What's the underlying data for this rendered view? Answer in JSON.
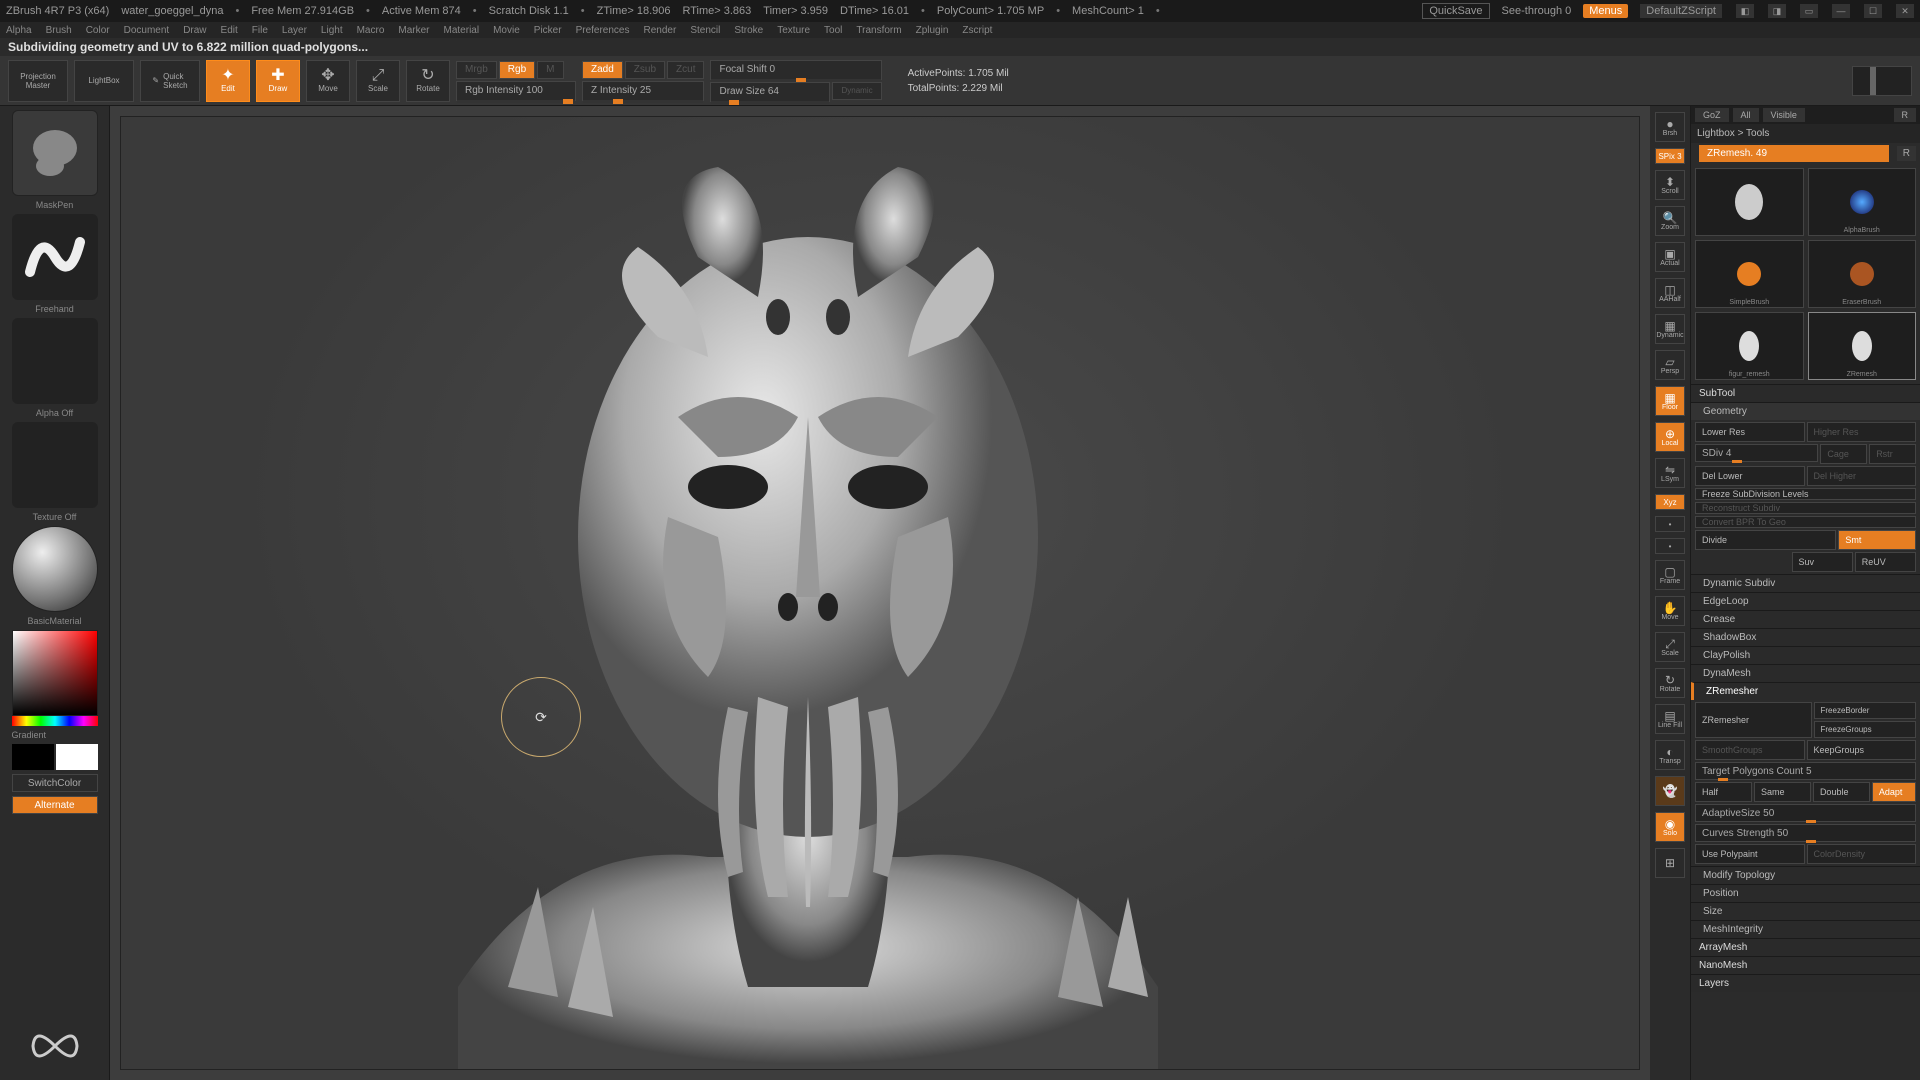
{
  "title_bar": {
    "app": "ZBrush 4R7 P3 (x64)",
    "file": "water_goeggel_dyna",
    "free_mem": "Free Mem 27.914GB",
    "active_mem": "Active Mem 874",
    "scratch": "Scratch Disk 1.1",
    "ztime": "ZTime> 18.906",
    "rtime": "RTime> 3.863",
    "timer": "Timer> 3.959",
    "dtime": "DTime> 16.01",
    "polycount": "PolyCount> 1.705 MP",
    "meshcount": "MeshCount> 1",
    "quicksave": "QuickSave",
    "seethrough": "See-through 0",
    "menus": "Menus",
    "script": "DefaultZScript"
  },
  "menu": [
    "Alpha",
    "Brush",
    "Color",
    "Document",
    "Draw",
    "Edit",
    "File",
    "Layer",
    "Light",
    "Macro",
    "Marker",
    "Material",
    "Movie",
    "Picker",
    "Preferences",
    "Render",
    "Stencil",
    "Stroke",
    "Texture",
    "Tool",
    "Transform",
    "Zplugin",
    "Zscript"
  ],
  "status": "Subdividing geometry and UV to 6.822 million quad-polygons...",
  "toolbar": {
    "projection_master": "Projection\nMaster",
    "lightbox": "LightBox",
    "quick_sketch": "Quick\nSketch",
    "edit": "Edit",
    "draw": "Draw",
    "move": "Move",
    "scale": "Scale",
    "rotate": "Rotate",
    "mrgb": "Mrgb",
    "rgb": "Rgb",
    "m": "M",
    "rgb_intensity": "Rgb Intensity 100",
    "zadd": "Zadd",
    "zsub": "Zsub",
    "zcut": "Zcut",
    "z_intensity": "Z Intensity 25",
    "focal_shift": "Focal Shift 0",
    "draw_size": "Draw Size 64",
    "dynamic": "Dynamic",
    "active_points": "ActivePoints: 1.705 Mil",
    "total_points": "TotalPoints: 2.229 Mil"
  },
  "left": {
    "mask_pen": "MaskPen",
    "freehand": "Freehand",
    "alpha_off": "Alpha Off",
    "texture_off": "Texture Off",
    "material": "BasicMaterial",
    "gradient": "Gradient",
    "switch_color": "SwitchColor",
    "alternate": "Alternate"
  },
  "right_strip": {
    "brsh": "Brsh",
    "spix": "SPix 3",
    "scroll": "Scroll",
    "zoom": "Zoom",
    "actual": "Actual",
    "aahalf": "AAHalf",
    "dynamic": "Dynamic",
    "persp": "Persp",
    "floor": "Floor",
    "local": "Local",
    "lsym": "LSym",
    "xyz": "Xyz",
    "frame": "Frame",
    "move": "Move",
    "scale": "Scale",
    "rotate": "Rotate",
    "linefill": "Line Fill",
    "transp": "Transp",
    "solo": "Solo"
  },
  "right_panel": {
    "tabs": {
      "goz": "GoZ",
      "all": "All",
      "visible": "Visible",
      "r": "R"
    },
    "crumb": "Lightbox > Tools",
    "tool_name": "ZRemesh. 49",
    "r2": "R",
    "thumbs": [
      "",
      "AlphaBrush",
      "SimpleBrush",
      "EraserBrush",
      "figur_remesh",
      "ZRemesh"
    ],
    "subtool": "SubTool",
    "geometry": "Geometry",
    "lower_res": "Lower Res",
    "higher_res": "Higher Res",
    "sdiv": "SDiv 4",
    "cage": "Cage",
    "rstr": "Rstr",
    "del_lower": "Del Lower",
    "del_higher": "Del Higher",
    "freeze_subdiv": "Freeze SubDivision Levels",
    "reconstruct": "Reconstruct Subdiv",
    "convert_bpr": "Convert BPR To Geo",
    "divide": "Divide",
    "smt": "Smt",
    "suv": "Suv",
    "reuv": "ReUV",
    "dynamic_subdiv": "Dynamic Subdiv",
    "edgeloop": "EdgeLoop",
    "crease": "Crease",
    "shadowbox": "ShadowBox",
    "claypolish": "ClayPolish",
    "dynamesh": "DynaMesh",
    "zremesher": "ZRemesher",
    "zremesher_btn": "ZRemesher",
    "freeze_border": "FreezeBorder",
    "smooth_groups": "SmoothGroups",
    "freeze_groups": "FreezeGroups",
    "keep_groups": "KeepGroups",
    "target_poly": "Target Polygons Count 5",
    "half": "Half",
    "same": "Same",
    "double": "Double",
    "adapt": "Adapt",
    "adaptive_size": "AdaptiveSize 50",
    "curves_strength": "Curves Strength 50",
    "use_polypaint": "Use Polypaint",
    "color_density": "ColorDensity",
    "modify_topology": "Modify Topology",
    "position": "Position",
    "size": "Size",
    "mesh_integrity": "MeshIntegrity",
    "arraymesh": "ArrayMesh",
    "nanomesh": "NanoMesh",
    "layers": "Layers"
  }
}
